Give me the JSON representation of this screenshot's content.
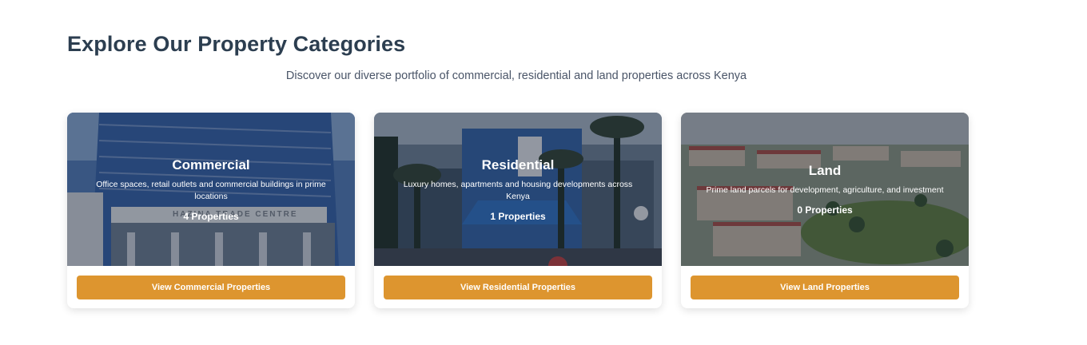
{
  "section": {
    "title": "Explore Our Property Categories",
    "subtitle": "Discover our diverse portfolio of commercial, residential and land properties across Kenya"
  },
  "colors": {
    "heading": "#2c3e50",
    "button": "#dd952f",
    "overlay": "#1c2638"
  },
  "categories": [
    {
      "title": "Commercial",
      "description": "Office spaces, retail outlets and commercial buildings in prime locations",
      "count": "4 Properties",
      "button": "View Commercial Properties",
      "sign_text": "HAZINA TRADE CENTRE"
    },
    {
      "title": "Residential",
      "description": "Luxury homes, apartments and housing developments across Kenya",
      "count": "1 Properties",
      "button": "View Residential Properties"
    },
    {
      "title": "Land",
      "description": "Prime land parcels for development, agriculture, and investment",
      "count": "0 Properties",
      "button": "View Land Properties"
    }
  ]
}
